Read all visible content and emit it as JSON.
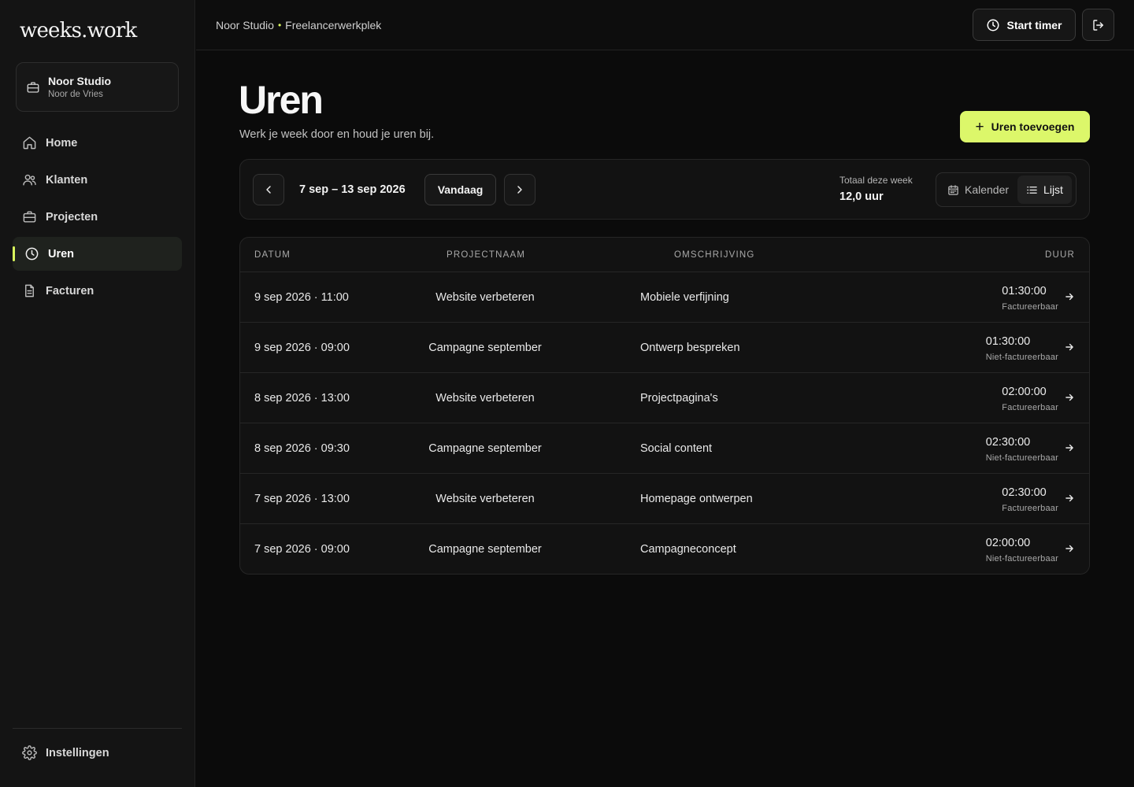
{
  "app": {
    "logo": "weeks.work"
  },
  "workspace": {
    "name": "Noor Studio",
    "owner": "Noor de Vries"
  },
  "nav": {
    "items": [
      {
        "label": "Home"
      },
      {
        "label": "Klanten"
      },
      {
        "label": "Projecten"
      },
      {
        "label": "Uren"
      },
      {
        "label": "Facturen"
      }
    ],
    "settings": "Instellingen"
  },
  "topbar": {
    "breadcrumb_workspace": "Noor Studio",
    "breadcrumb_separator": "•",
    "breadcrumb_context": "Freelancerwerkplek",
    "start_timer": "Start timer"
  },
  "page": {
    "title": "Uren",
    "subtitle": "Werk je week door en houd je uren bij.",
    "add_button": "Uren toevoegen"
  },
  "week": {
    "range": "7 sep – 13 sep 2026",
    "today": "Vandaag",
    "total_label": "Totaal deze week",
    "total_value": "12,0 uur",
    "views": [
      "Kalender",
      "Lijst"
    ],
    "active_view": "Lijst"
  },
  "table": {
    "headers": {
      "date": "DATUM",
      "project": "PROJECTNAAM",
      "description": "OMSCHRIJVING",
      "duration": "DUUR"
    },
    "rows": [
      {
        "date": "9 sep 2026 · 11:00",
        "project": "Website verbeteren",
        "description": "Mobiele verfijning",
        "duration": "01:30:00",
        "billing": "Factureerbaar"
      },
      {
        "date": "9 sep 2026 · 09:00",
        "project": "Campagne september",
        "description": "Ontwerp bespreken",
        "duration": "01:30:00",
        "billing": "Niet-factureerbaar"
      },
      {
        "date": "8 sep 2026 · 13:00",
        "project": "Website verbeteren",
        "description": "Projectpagina's",
        "duration": "02:00:00",
        "billing": "Factureerbaar"
      },
      {
        "date": "8 sep 2026 · 09:30",
        "project": "Campagne september",
        "description": "Social content",
        "duration": "02:30:00",
        "billing": "Niet-factureerbaar"
      },
      {
        "date": "7 sep 2026 · 13:00",
        "project": "Website verbeteren",
        "description": "Homepage ontwerpen",
        "duration": "02:30:00",
        "billing": "Factureerbaar"
      },
      {
        "date": "7 sep 2026 · 09:00",
        "project": "Campagne september",
        "description": "Campagneconcept",
        "duration": "02:00:00",
        "billing": "Niet-factureerbaar"
      }
    ]
  },
  "colors": {
    "accent": "#dcf76a",
    "background": "#0b0b0b",
    "surface": "#121212",
    "sidebar": "#141414"
  },
  "icons": {
    "workspace": "briefcase-icon",
    "home": "home-icon",
    "klanten": "users-icon",
    "projecten": "briefcase-icon",
    "uren": "clock-icon",
    "facturen": "document-icon",
    "settings": "gear-icon",
    "timer": "clock-icon",
    "logout": "logout-icon",
    "add": "plus-icon",
    "prev": "chevron-left-icon",
    "next": "chevron-right-icon",
    "calendar": "calendar-icon",
    "list": "list-icon",
    "row": "arrow-right-icon"
  }
}
